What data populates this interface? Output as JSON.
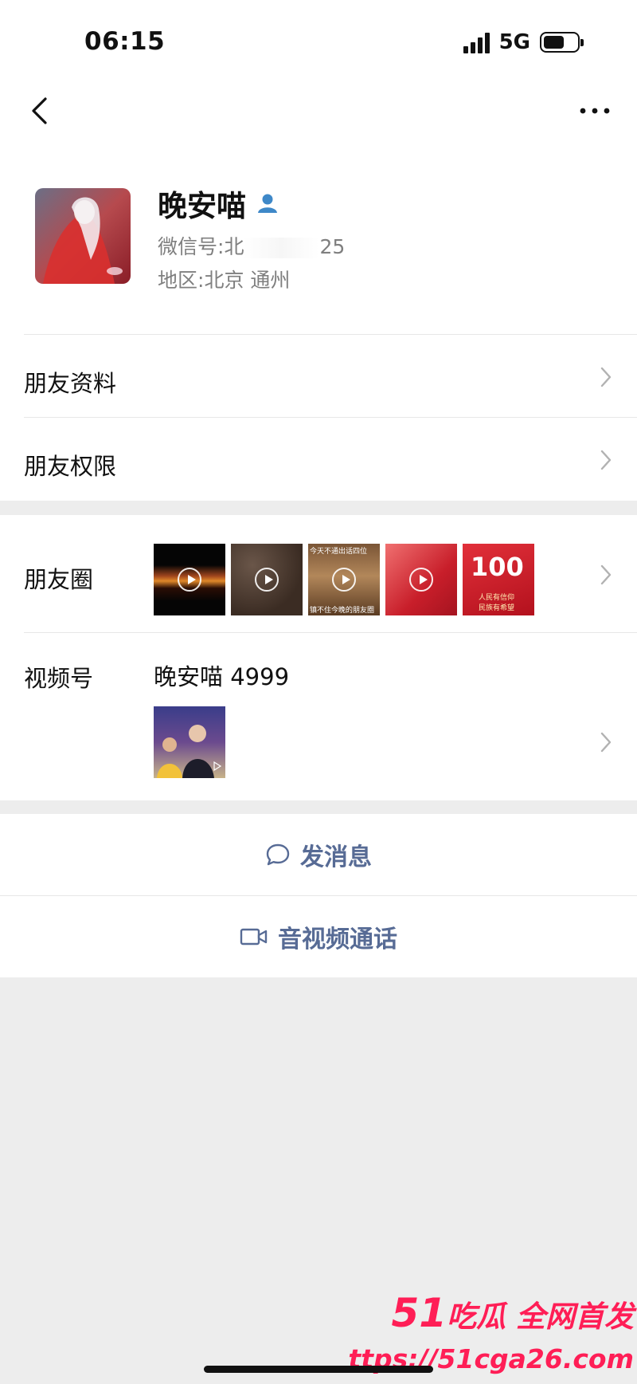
{
  "status_bar": {
    "time": "06:15",
    "network": "5G"
  },
  "profile": {
    "name": "晚安喵",
    "wechat_id_label": "微信号:",
    "wechat_id_start": "北",
    "wechat_id_end": "25",
    "region_label": "地区:",
    "region_value": "北京 通州"
  },
  "menu": {
    "friend_info": "朋友资料",
    "friend_permissions": "朋友权限",
    "moments": "朋友圈",
    "channels": "视频号",
    "channels_account": "晚安喵 4999"
  },
  "moments_thumbs": {
    "t3_caption_top": "今天不通出话四位",
    "t3_caption_bottom": "镇不住今晚的朋友圈",
    "t5_number": "100",
    "t5_line1": "人民有信仰",
    "t5_line2": "民族有希望"
  },
  "actions": {
    "message": "发消息",
    "call": "音视频通话"
  },
  "watermark": {
    "brand_num": "51",
    "brand_text": "吃瓜 全网首发",
    "url": "ttps://51cga26.com"
  }
}
